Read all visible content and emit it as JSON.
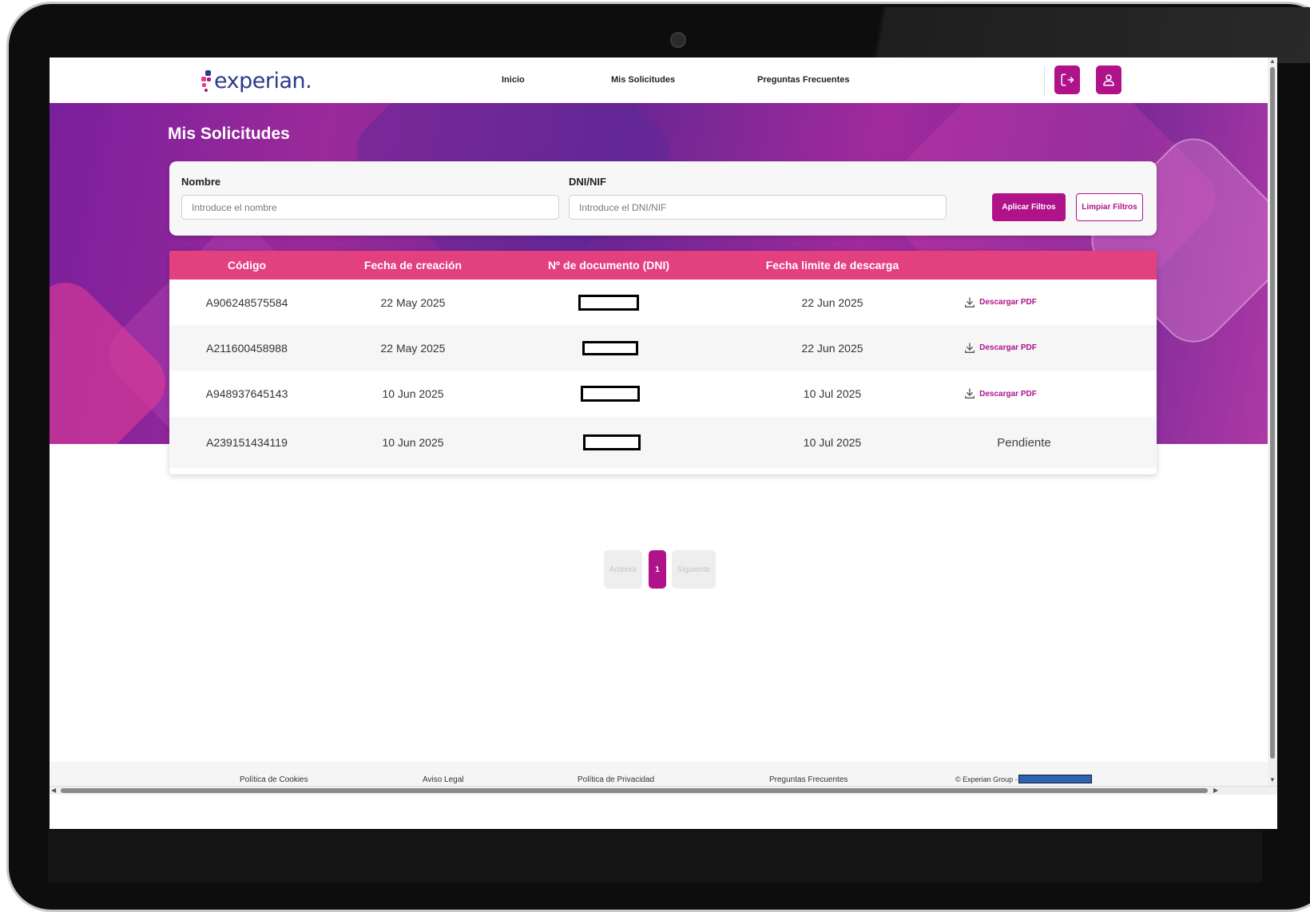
{
  "brand": {
    "logo_text": "experian.",
    "accent": "#b0128a",
    "table_header": "#e2407f"
  },
  "nav": {
    "items": [
      "Inicio",
      "Mis Solicitudes",
      "Preguntas Frecuentes"
    ]
  },
  "header_buttons": {
    "logout_icon": "logout-icon",
    "user_icon": "user-icon"
  },
  "page": {
    "title": "Mis Solicitudes"
  },
  "filters": {
    "name_label": "Nombre",
    "name_placeholder": "Introduce el nombre",
    "dni_label": "DNI/NIF",
    "dni_placeholder": "Introduce el DNI/NIF",
    "apply_label": "Aplicar Filtros",
    "clear_label": "Limpiar Filtros"
  },
  "table": {
    "headers": [
      "Código",
      "Fecha de creación",
      "Nº de documento (DNI)",
      "Fecha limite de descarga",
      ""
    ],
    "rows": [
      {
        "codigo": "A906248575584",
        "creacion": "22 May 2025",
        "limite": "22 Jun 2025",
        "action": "Descargar PDF"
      },
      {
        "codigo": "A211600458988",
        "creacion": "22 May 2025",
        "limite": "22 Jun 2025",
        "action": "Descargar PDF"
      },
      {
        "codigo": "A948937645143",
        "creacion": "10 Jun 2025",
        "limite": "10 Jul 2025",
        "action": "Descargar PDF"
      },
      {
        "codigo": "A239151434119",
        "creacion": "10 Jun 2025",
        "limite": "10 Jul 2025",
        "action": "Pendiente"
      }
    ]
  },
  "pagination": {
    "prev": "Anterior",
    "current": "1",
    "next": "Siguiente"
  },
  "footer": {
    "links": [
      "Política de Cookies",
      "Aviso Legal",
      "Política de Privacidad",
      "Preguntas Frecuentes"
    ],
    "copyright": "© Experian Group -"
  }
}
